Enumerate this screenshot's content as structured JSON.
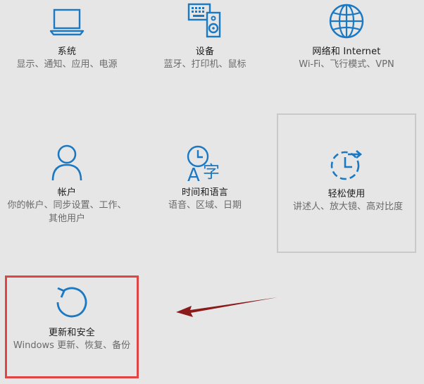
{
  "tiles": [
    {
      "id": "system",
      "title": "系统",
      "desc": "显示、通知、应用、电源",
      "icon": "laptop-icon"
    },
    {
      "id": "devices",
      "title": "设备",
      "desc": "蓝牙、打印机、鼠标",
      "icon": "devices-icon"
    },
    {
      "id": "network",
      "title": "网络和 Internet",
      "desc": "Wi-Fi、飞行模式、VPN",
      "icon": "globe-icon"
    },
    {
      "id": "accounts",
      "title": "帐户",
      "desc": "你的帐户、同步设置、工作、其他用户",
      "icon": "person-icon"
    },
    {
      "id": "time-language",
      "title": "时间和语言",
      "desc": "语音、区域、日期",
      "icon": "time-language-icon"
    },
    {
      "id": "ease-of-access",
      "title": "轻松使用",
      "desc": "讲述人、放大镜、高对比度",
      "icon": "ease-of-access-icon"
    },
    {
      "id": "update-security",
      "title": "更新和安全",
      "desc": "Windows 更新、恢复、备份",
      "icon": "refresh-icon"
    }
  ],
  "colors": {
    "background": "#e6e6e6",
    "accent": "#1b79c4",
    "highlight": "#e04545",
    "arrow": "#8b1a1a"
  }
}
